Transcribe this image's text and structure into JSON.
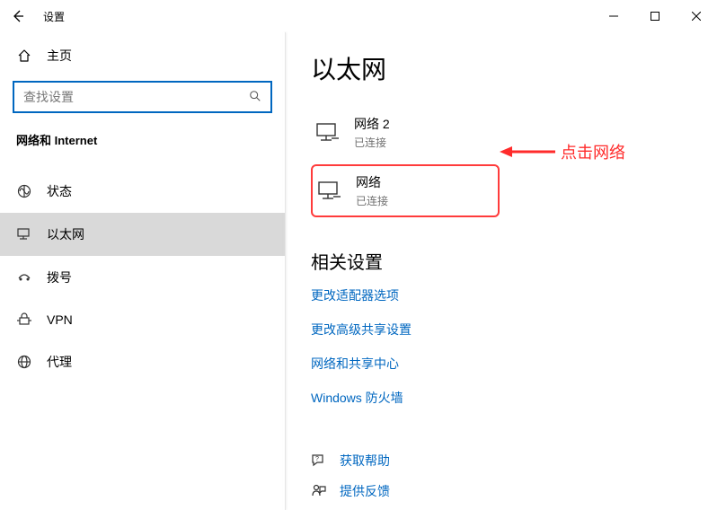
{
  "window": {
    "title": "设置"
  },
  "sidebar": {
    "home_label": "主页",
    "search_placeholder": "查找设置",
    "category": "网络和 Internet",
    "items": [
      {
        "label": "状态"
      },
      {
        "label": "以太网"
      },
      {
        "label": "拨号"
      },
      {
        "label": "VPN"
      },
      {
        "label": "代理"
      }
    ]
  },
  "main": {
    "title": "以太网",
    "networks": [
      {
        "name": "网络  2",
        "status": "已连接"
      },
      {
        "name": "网络",
        "status": "已连接"
      }
    ],
    "related_title": "相关设置",
    "links": [
      "更改适配器选项",
      "更改高级共享设置",
      "网络和共享中心",
      "Windows 防火墙"
    ],
    "help": "获取帮助",
    "feedback": "提供反馈"
  },
  "annotation": {
    "text": "点击网络"
  }
}
